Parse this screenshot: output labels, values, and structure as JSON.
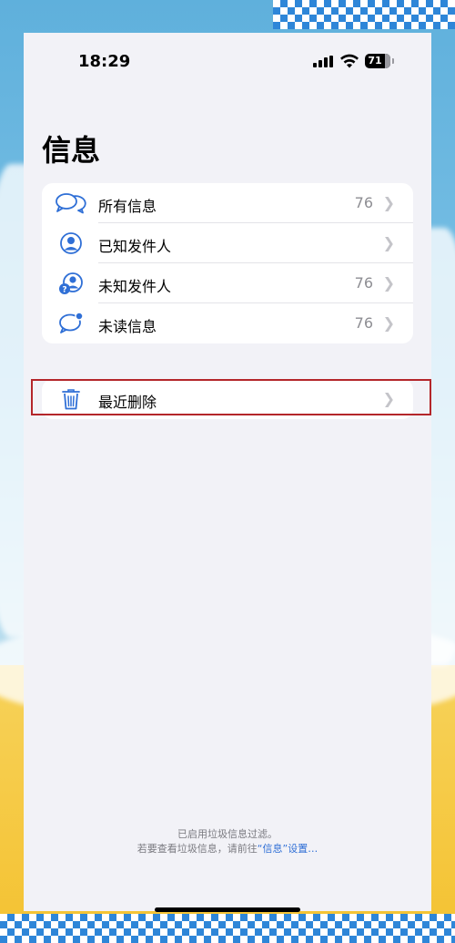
{
  "status_bar": {
    "time": "18:29",
    "battery": "71",
    "icons": [
      "cellular-signal-icon",
      "wifi-icon",
      "battery-icon"
    ]
  },
  "page": {
    "title": "信息"
  },
  "filters": [
    {
      "label": "所有信息",
      "count": "76",
      "icon": "speech-bubbles-icon"
    },
    {
      "label": "已知发件人",
      "count": "",
      "icon": "person-circle-icon"
    },
    {
      "label": "未知发件人",
      "count": "76",
      "icon": "unknown-person-icon"
    },
    {
      "label": "未读信息",
      "count": "76",
      "icon": "unread-bubble-icon"
    }
  ],
  "recently_deleted": {
    "label": "最近删除",
    "icon": "trash-icon"
  },
  "footer": {
    "line1": "已启用垃圾信息过滤。",
    "line2_prefix": "若要查看垃圾信息，请前往",
    "link_text": "“信息”设置…"
  },
  "colors": {
    "accent": "#2f6fd6",
    "highlight": "#b4262a",
    "background": "#f2f2f7"
  }
}
